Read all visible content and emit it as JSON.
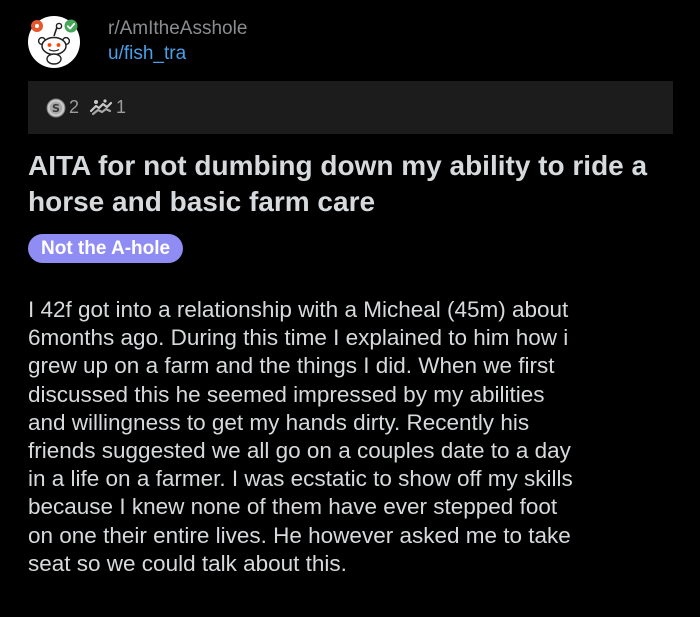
{
  "header": {
    "subreddit": "r/AmItheAsshole",
    "username": "u/fish_tra",
    "avatar_icon": "snoo-avatar-icon"
  },
  "awards": [
    {
      "icon": "silver-award-icon",
      "count": "2"
    },
    {
      "icon": "helpful-award-icon",
      "count": "1"
    }
  ],
  "post": {
    "title": "AITA for not dumbing down my ability to ride a horse and basic farm care",
    "flair": "Not the A-hole",
    "body_lines": [
      "I 42f got into a relationship with a Micheal (45m) about",
      "6months ago. During this time I explained to him how i",
      "grew up on a farm and the things I did. When we first",
      "discussed this he seemed impressed by my abilities",
      "and willingness to get my hands dirty. Recently his",
      "friends suggested we all go on a couples date to a day",
      "in a life on a farmer. I was ecstatic to show off my skills",
      "because I knew none of them have ever stepped foot",
      "on one their entire lives. He however asked me to take",
      "seat so we could talk about this."
    ]
  },
  "colors": {
    "background": "#000000",
    "text": "#d7dadc",
    "muted": "#8a8d90",
    "link": "#4a9fe8",
    "flair": "#8f8cf3",
    "awards_bar": "#1c1c1d"
  }
}
